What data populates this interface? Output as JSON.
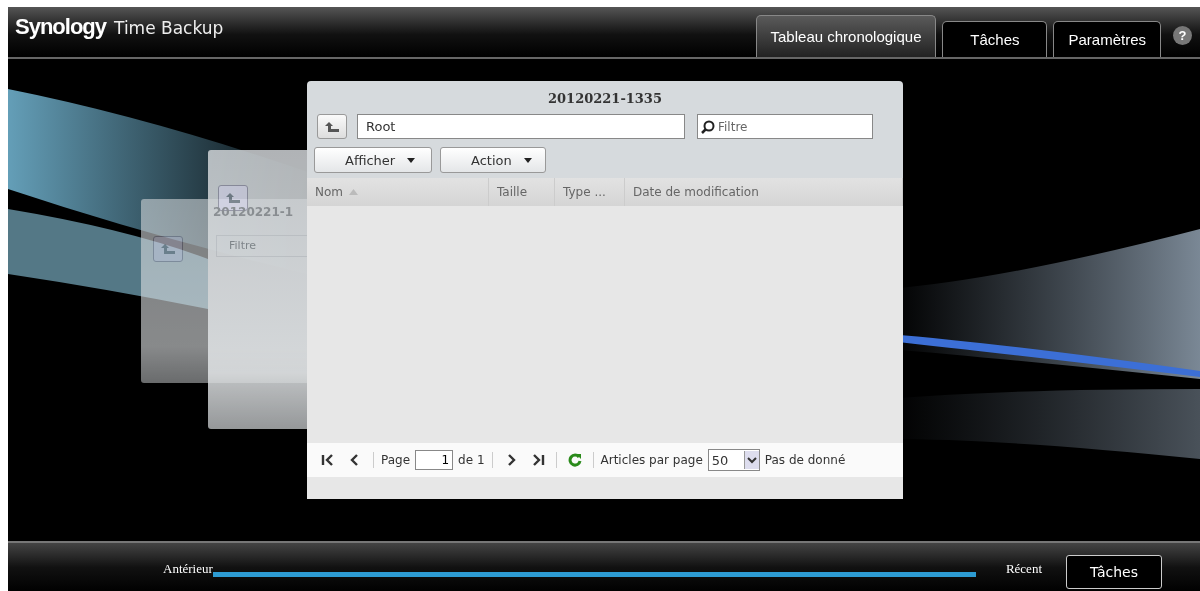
{
  "app": {
    "brand": "Synology",
    "product": "Time Backup"
  },
  "help": "?",
  "tabs": [
    {
      "label": "Tableau chronologique",
      "selected": true
    },
    {
      "label": "Tâches",
      "selected": false
    },
    {
      "label": "Paramètres",
      "selected": false
    }
  ],
  "back_window": {
    "title": "20120221-1",
    "filter_placeholder": "Filtre"
  },
  "dialog": {
    "title": "20120221-1335",
    "path": "Root",
    "filter_placeholder": "Filtre",
    "buttons": [
      "Afficher",
      "Action"
    ],
    "columns": [
      {
        "label": "Nom",
        "sorted": true
      },
      {
        "label": "Taille",
        "sorted": false
      },
      {
        "label": "Type ...",
        "sorted": false
      },
      {
        "label": "Date de modification",
        "sorted": false
      }
    ],
    "pager": {
      "page_label": "Page",
      "page": "1",
      "of": "de 1",
      "per_page_label": "Articles par page",
      "per_page": "50",
      "status": "Pas de donné"
    }
  },
  "timeline": {
    "start": "Antérieur",
    "end": "Récent",
    "button": "Tâches"
  }
}
